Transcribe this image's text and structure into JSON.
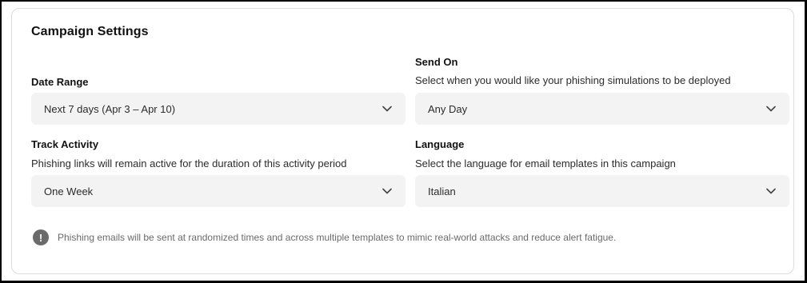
{
  "card": {
    "title": "Campaign Settings"
  },
  "fields": {
    "date_range": {
      "label": "Date Range",
      "value": "Next 7 days (Apr 3 – Apr 10)"
    },
    "send_on": {
      "label": "Send On",
      "description": "Select when you would like your phishing simulations to be deployed",
      "value": "Any Day"
    },
    "track_activity": {
      "label": "Track Activity",
      "description": "Phishing links will remain active for the duration of this activity period",
      "value": "One Week"
    },
    "language": {
      "label": "Language",
      "description": "Select the language for email templates in this campaign",
      "value": "Italian"
    }
  },
  "notice": {
    "icon": "exclamation-icon",
    "glyph": "!",
    "text": "Phishing emails will be sent at randomized times and across multiple templates to mimic real-world attacks and reduce alert fatigue."
  },
  "colors": {
    "select_bg": "#f3f3f3",
    "notice_icon_bg": "#6b6b6b",
    "border": "#dcdcdc"
  }
}
